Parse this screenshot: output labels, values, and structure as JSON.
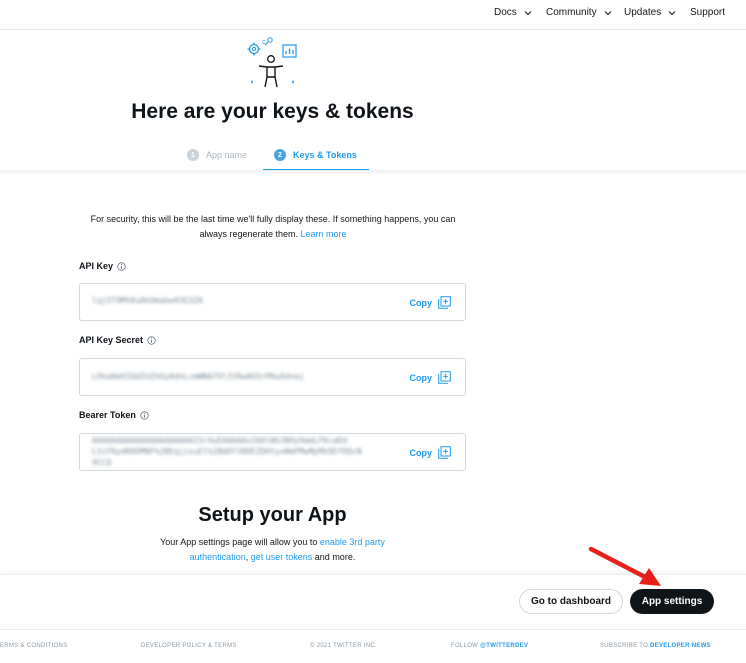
{
  "nav": {
    "docs": "Docs",
    "community": "Community",
    "updates": "Updates",
    "support": "Support"
  },
  "hero": {
    "title": "Here are your keys & tokens"
  },
  "steps": [
    {
      "num": "1",
      "label": "App name"
    },
    {
      "num": "2",
      "label": "Keys & Tokens"
    }
  ],
  "notice": {
    "text": "For security, this will be the last time we'll fully display these. If something happens, you can always regenerate them.",
    "link": "Learn more"
  },
  "fields": {
    "api_key": {
      "label": "API Key",
      "value": "lqjST9Mh0uAkOmabw93G3ZA",
      "copy": "Copy"
    },
    "api_secret": {
      "label": "API Key Secret",
      "value": "LOkaAmVIQdIUZhUyAdnLcmWNA7Vl31RwAO3rPKwXdnaj",
      "copy": "Copy"
    },
    "bearer": {
      "label": "Bearer Token",
      "value_line1": "AAAAAAAAAAAAAAAAAAAAAI5rXwEAAAAAoIA0lWUJBOy9amLFKcaDd",
      "value_line2": "LSiFKp4N9DMNF%2BEqjzsuEl%2BmDY1N9EZDHtyoNmPMwMpMk9EfDQcN",
      "value_line3": "9CCQ",
      "copy": "Copy"
    }
  },
  "setup": {
    "title": "Setup your App",
    "desc_prefix": "Your App settings page will allow you to",
    "link1": "enable 3rd party authentication",
    "sep": ",",
    "link2": "get user tokens",
    "desc_suffix": "and more."
  },
  "actions": {
    "dashboard": "Go to dashboard",
    "app_settings": "App settings"
  },
  "footer": {
    "terms": "ERMS & CONDITIONS",
    "policy": "DEVELOPER POLICY & TERMS",
    "copyright": "© 2021 TWITTER INC.",
    "follow_prefix": "FOLLOW",
    "follow_handle": "@TWITTERDEV",
    "subscribe_prefix": "SUBSCRIBE TO",
    "subscribe_link": "DEVELOPER NEWS"
  },
  "colors": {
    "accent": "#1d9bf0",
    "dark": "#0f1419",
    "annotation_arrow": "#e8201a"
  },
  "icons": {
    "hero": "developer-person-gear-chart-icon",
    "nav_chevron": "chevron-down-icon",
    "info": "info-circle-icon",
    "copy": "copy-plus-icon",
    "annotation": "red-arrow-icon"
  }
}
